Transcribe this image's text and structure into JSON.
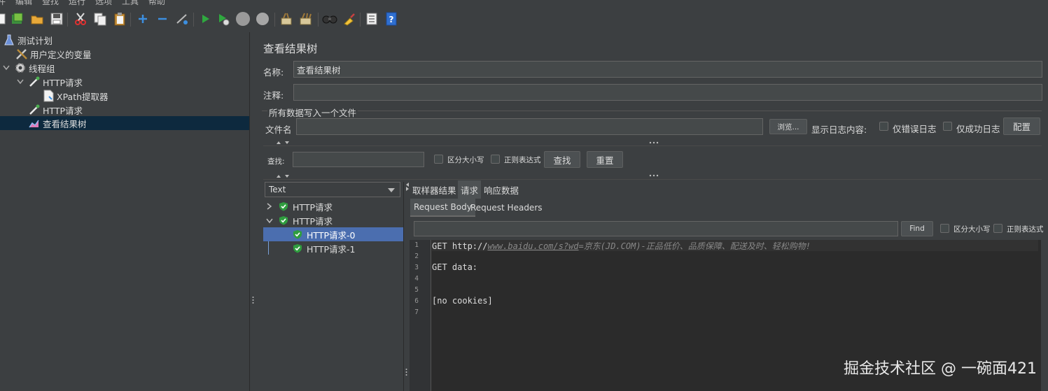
{
  "menu": [
    "件",
    "编辑",
    "查找",
    "运行",
    "选项",
    "工具",
    "帮助"
  ],
  "toolbar": {
    "icons": [
      "new-icon",
      "templates-icon",
      "open-icon",
      "save-icon",
      "cut-icon",
      "copy-icon",
      "paste-icon",
      "expand-icon",
      "collapse-icon",
      "toggle-icon",
      "start-icon",
      "start-no-pause-icon",
      "stop-icon",
      "shutdown-icon",
      "clear-icon",
      "clear-all-icon",
      "search-icon",
      "reset-search-icon",
      "function-helper-icon",
      "help-icon"
    ]
  },
  "tree": {
    "items": [
      {
        "label": "测试计划",
        "icon": "flask-icon"
      },
      {
        "label": "用户定义的变量",
        "icon": "wrench-icon"
      },
      {
        "label": "线程组",
        "icon": "gear-icon"
      },
      {
        "label": "HTTP请求",
        "icon": "pipette-icon"
      },
      {
        "label": "XPath提取器",
        "icon": "document-icon"
      },
      {
        "label": "HTTP请求",
        "icon": "pipette-icon"
      },
      {
        "label": "查看结果树",
        "icon": "chart-icon"
      }
    ],
    "selected_index": 6
  },
  "panel": {
    "title": "查看结果树",
    "name_label": "名称:",
    "name_value": "查看结果树",
    "comment_label": "注释:",
    "comment_value": "",
    "file_section_label": "所有数据写入一个文件",
    "filename_label": "文件名",
    "filename_value": "",
    "browse_label": "浏览...",
    "log_display_label": "显示日志内容:",
    "errors_only_label": "仅错误日志",
    "success_only_label": "仅成功日志",
    "configure_label": "配置",
    "search_label": "查找:",
    "search_value": "",
    "case_sensitive_label": "区分大小写",
    "regex_label": "正则表达式",
    "find_button_label": "查找",
    "reset_button_label": "重置"
  },
  "results": {
    "renderer": "Text",
    "items": [
      {
        "label": "HTTP请求",
        "expanded": false,
        "level": 0
      },
      {
        "label": "HTTP请求",
        "expanded": true,
        "level": 0
      },
      {
        "label": "HTTP请求-0",
        "level": 1,
        "selected": true
      },
      {
        "label": "HTTP请求-1",
        "level": 1
      }
    ]
  },
  "tabs": {
    "items": [
      "取样器结果",
      "请求",
      "响应数据"
    ],
    "active": 1,
    "subtabs": [
      "Request Body",
      "Request Headers"
    ],
    "active_subtab": 0,
    "find_button": "Find",
    "case_sensitive_label": "区分大小写",
    "regex_label": "正则表达式"
  },
  "code": {
    "line_numbers": [
      "1",
      "2",
      "3",
      "4",
      "5",
      "6",
      "7"
    ],
    "line1_prefix": "GET http://",
    "line1_url": "www.baidu.com/s?wd",
    "line1_rest": "=京东(JD.COM)-正品低价、品质保障、配送及时、轻松购物!",
    "line3": "GET data:",
    "line6": "[no cookies]"
  },
  "watermark": "掘金技术社区 @ 一碗面421",
  "colors": {
    "background": "#3c3f41",
    "selection_tree": "#0d293e",
    "selection_results": "#4b6eaf",
    "editor_background": "#2b2b2b",
    "shield_green": "#2f9d3f"
  }
}
